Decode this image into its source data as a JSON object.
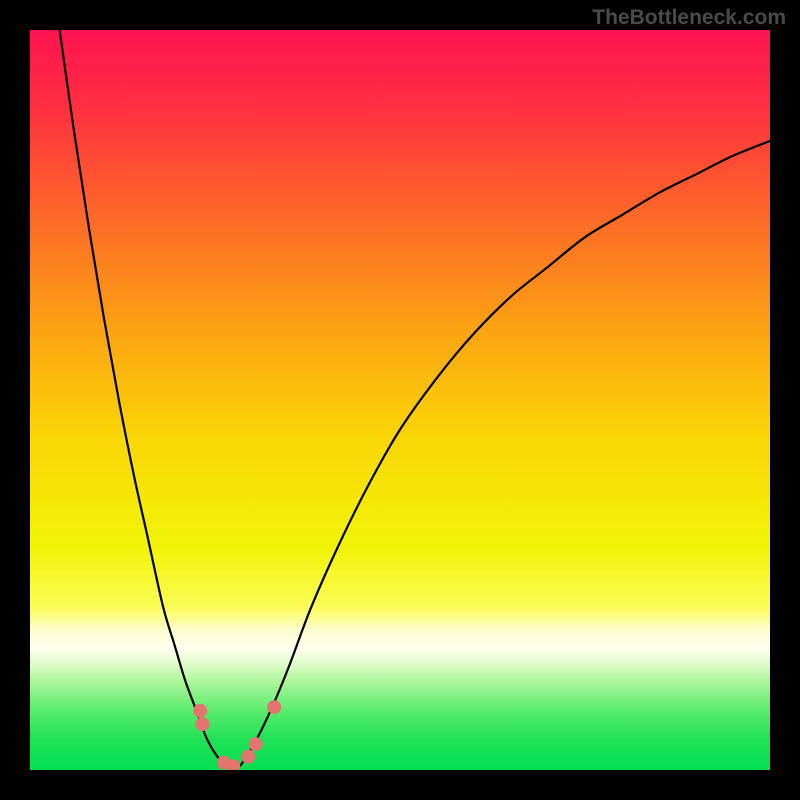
{
  "watermark": "TheBottleneck.com",
  "chart_data": {
    "type": "line",
    "title": "",
    "xlabel": "",
    "ylabel": "",
    "xlim": [
      0,
      100
    ],
    "ylim": [
      0,
      100
    ],
    "grid": false,
    "legend": false,
    "series": [
      {
        "name": "curve-left",
        "x": [
          4,
          6,
          8,
          10,
          12,
          14,
          16,
          18,
          19.5,
          21,
          22.5,
          24,
          26,
          28
        ],
        "y": [
          100,
          86,
          73,
          61,
          50,
          40,
          31,
          22,
          17,
          12,
          8,
          4,
          1,
          0
        ]
      },
      {
        "name": "curve-right",
        "x": [
          28,
          30,
          32.5,
          35,
          38,
          42,
          46,
          50,
          55,
          60,
          65,
          70,
          75,
          80,
          85,
          90,
          95,
          100
        ],
        "y": [
          0,
          3,
          8,
          14,
          22,
          31,
          39,
          46,
          53,
          59,
          64,
          68,
          72,
          75,
          78,
          80.5,
          83,
          85
        ]
      }
    ],
    "dots": {
      "name": "highlight-points",
      "color": "#e2766e",
      "points": [
        {
          "x": 23.0,
          "y": 8.0
        },
        {
          "x": 23.3,
          "y": 6.2
        },
        {
          "x": 26.2,
          "y": 1.0
        },
        {
          "x": 27.5,
          "y": 0.5
        },
        {
          "x": 29.5,
          "y": 1.8
        },
        {
          "x": 30.5,
          "y": 3.5
        },
        {
          "x": 33.0,
          "y": 8.5
        }
      ]
    },
    "background": {
      "type": "vertical-gradient",
      "stops": [
        {
          "offset": 0.0,
          "color": "#fe1350"
        },
        {
          "offset": 0.1,
          "color": "#fe2e42"
        },
        {
          "offset": 0.25,
          "color": "#fd6828"
        },
        {
          "offset": 0.4,
          "color": "#fca113"
        },
        {
          "offset": 0.55,
          "color": "#fad606"
        },
        {
          "offset": 0.7,
          "color": "#f2f408"
        },
        {
          "offset": 0.78,
          "color": "#fbfd58"
        },
        {
          "offset": 0.81,
          "color": "#fdfecd"
        },
        {
          "offset": 0.835,
          "color": "#feffef"
        },
        {
          "offset": 0.855,
          "color": "#e4fccd"
        },
        {
          "offset": 0.88,
          "color": "#adf69a"
        },
        {
          "offset": 0.92,
          "color": "#5aec6d"
        },
        {
          "offset": 0.96,
          "color": "#1ee257"
        },
        {
          "offset": 1.0,
          "color": "#04df51"
        }
      ]
    }
  }
}
